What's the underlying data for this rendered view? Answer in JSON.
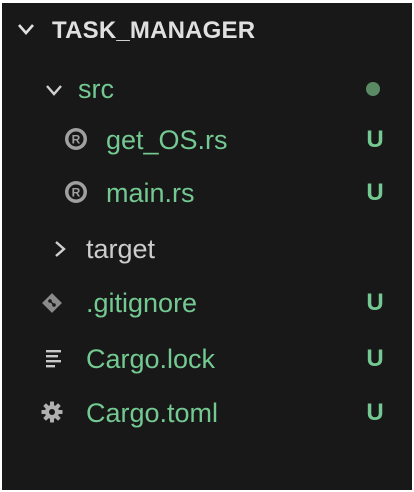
{
  "explorer": {
    "title": "TASK_MANAGER",
    "items": [
      {
        "label": "src",
        "status": "",
        "icon": "chevron-down-icon"
      },
      {
        "label": "get_OS.rs",
        "status": "U",
        "icon": "rust-file-icon"
      },
      {
        "label": "main.rs",
        "status": "U",
        "icon": "rust-file-icon"
      },
      {
        "label": "target",
        "status": "",
        "icon": "chevron-right-icon"
      },
      {
        "label": ".gitignore",
        "status": "U",
        "icon": "git-icon"
      },
      {
        "label": "Cargo.lock",
        "status": "U",
        "icon": "lines-icon"
      },
      {
        "label": "Cargo.toml",
        "status": "U",
        "icon": "gear-icon"
      }
    ]
  },
  "colors": {
    "background": "#181818",
    "untracked_green": "#73c991",
    "default_text": "#cccccc",
    "header_text": "#e0e0e0",
    "icon_grey": "#a0a0a0",
    "folder_dot": "#5a8a63"
  }
}
